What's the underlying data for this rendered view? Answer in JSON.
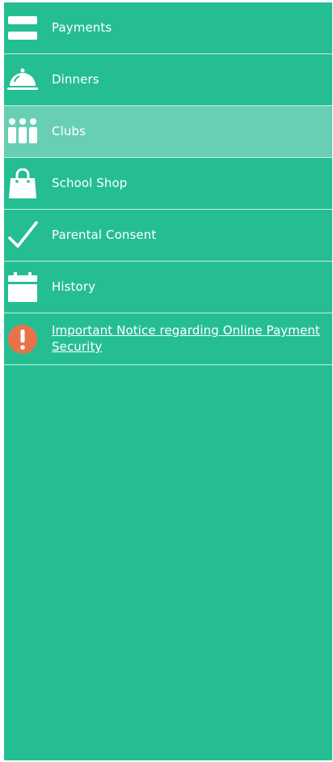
{
  "menu": {
    "items": [
      {
        "label": "Payments",
        "icon": "credit-card-icon"
      },
      {
        "label": "Dinners",
        "icon": "cloche-icon"
      },
      {
        "label": "Clubs",
        "icon": "group-icon"
      },
      {
        "label": "School Shop",
        "icon": "shopping-bag-icon"
      },
      {
        "label": "Parental Consent",
        "icon": "checkmark-icon"
      },
      {
        "label": "History",
        "icon": "calendar-icon"
      },
      {
        "label": "Important Notice regarding Online Payment Security",
        "icon": "warning-icon"
      }
    ],
    "active_index": 2
  },
  "colors": {
    "background": "#25be93",
    "active": "#69cfb4",
    "divider": "#c8ede2",
    "warning": "#e8734a"
  }
}
